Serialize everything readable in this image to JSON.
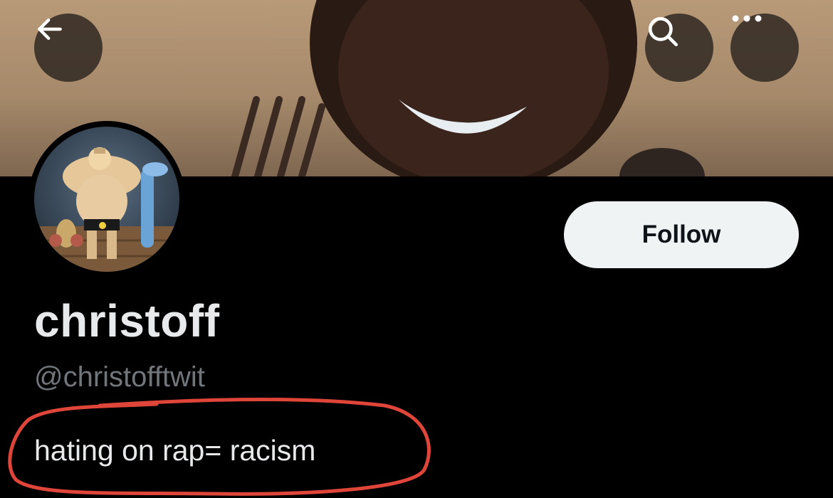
{
  "profile": {
    "display_name": "christoff",
    "handle": "@christofftwit",
    "bio": "hating on rap= racism"
  },
  "actions": {
    "follow_label": "Follow"
  },
  "icons": {
    "back": "arrow-left-icon",
    "search": "search-icon",
    "more": "more-horizontal-icon"
  },
  "colors": {
    "background": "#000000",
    "follow_button_bg": "#eff3f4",
    "handle_text": "#71767b",
    "annotation_red": "#e0453a"
  }
}
